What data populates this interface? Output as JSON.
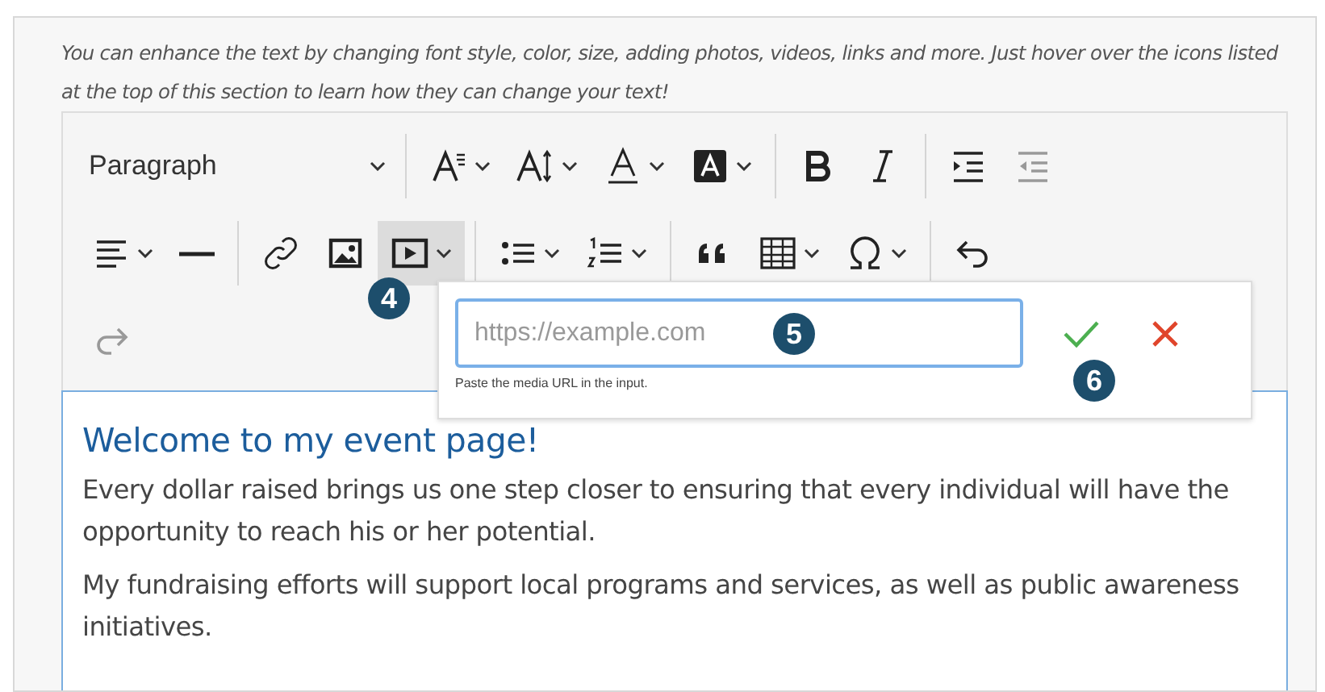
{
  "hint": "You can enhance the text by changing font style, color, size, adding photos, videos, links and more. Just hover over the icons listed at the top of this section to learn how they can change your text!",
  "toolbar": {
    "block_format": "Paragraph",
    "rows": [
      [
        {
          "kind": "font-style",
          "caret": true,
          "separator_before": true,
          "active": false
        },
        {
          "kind": "font-size",
          "caret": true,
          "separator_before": false,
          "active": false
        },
        {
          "kind": "font-color",
          "caret": true,
          "separator_before": false,
          "active": false
        },
        {
          "kind": "highlight",
          "caret": true,
          "separator_before": false,
          "active": false
        },
        {
          "kind": "bold",
          "caret": false,
          "separator_before": true,
          "active": false
        },
        {
          "kind": "italic",
          "caret": false,
          "separator_before": false,
          "active": false
        },
        {
          "kind": "indent",
          "caret": false,
          "separator_before": true,
          "active": false
        },
        {
          "kind": "outdent",
          "caret": false,
          "separator_before": false,
          "active": false
        }
      ],
      [
        {
          "kind": "align",
          "caret": true,
          "separator_before": false,
          "active": false
        },
        {
          "kind": "rule",
          "caret": false,
          "separator_before": false,
          "active": false
        },
        {
          "kind": "link",
          "caret": false,
          "separator_before": true,
          "active": false
        },
        {
          "kind": "image",
          "caret": false,
          "separator_before": false,
          "active": false
        },
        {
          "kind": "media",
          "caret": true,
          "separator_before": false,
          "active": true
        },
        {
          "kind": "bullets",
          "caret": true,
          "separator_before": true,
          "active": false
        },
        {
          "kind": "numbers",
          "caret": true,
          "separator_before": false,
          "active": false
        },
        {
          "kind": "quote",
          "caret": false,
          "separator_before": true,
          "active": false
        },
        {
          "kind": "table",
          "caret": true,
          "separator_before": false,
          "active": false
        },
        {
          "kind": "omega",
          "caret": true,
          "separator_before": false,
          "active": false
        },
        {
          "kind": "undo",
          "caret": false,
          "separator_before": true,
          "active": false
        }
      ],
      [
        {
          "kind": "redo",
          "caret": false,
          "separator_before": false,
          "active": false
        }
      ]
    ]
  },
  "media_popup": {
    "placeholder": "https://example.com",
    "help": "Paste the media URL in the input."
  },
  "callouts": [
    "4",
    "5",
    "6"
  ],
  "content": {
    "heading": "Welcome to my event page!",
    "paragraphs": [
      "Every dollar raised brings us one step closer to ensuring that every individual will have the opportunity to reach his or her potential.",
      "My fundraising efforts will support local programs and services, as well as public awareness initiatives."
    ]
  }
}
